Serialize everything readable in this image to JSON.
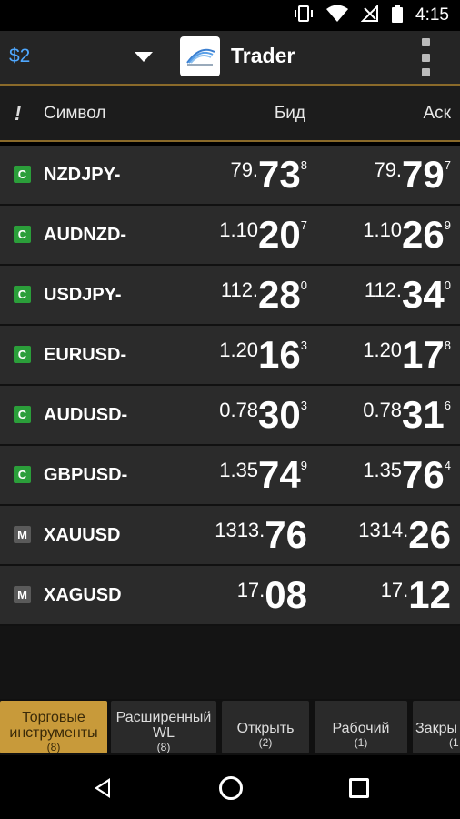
{
  "status_bar": {
    "time": "4:15"
  },
  "app_bar": {
    "balance": "$2",
    "app_name": "Trader"
  },
  "column_headers": {
    "alert": "!",
    "symbol": "Символ",
    "bid": "Бид",
    "ask": "Аск"
  },
  "rows": [
    {
      "badge": "C",
      "symbol": "NZDJPY-",
      "bid": {
        "pre": "79.",
        "big": "73",
        "sup": "8"
      },
      "ask": {
        "pre": "79.",
        "big": "79",
        "sup": "7"
      }
    },
    {
      "badge": "C",
      "symbol": "AUDNZD-",
      "bid": {
        "pre": "1.10",
        "big": "20",
        "sup": "7"
      },
      "ask": {
        "pre": "1.10",
        "big": "26",
        "sup": "9"
      }
    },
    {
      "badge": "C",
      "symbol": "USDJPY-",
      "bid": {
        "pre": "112.",
        "big": "28",
        "sup": "0"
      },
      "ask": {
        "pre": "112.",
        "big": "34",
        "sup": "0"
      }
    },
    {
      "badge": "C",
      "symbol": "EURUSD-",
      "bid": {
        "pre": "1.20",
        "big": "16",
        "sup": "3"
      },
      "ask": {
        "pre": "1.20",
        "big": "17",
        "sup": "8"
      }
    },
    {
      "badge": "C",
      "symbol": "AUDUSD-",
      "bid": {
        "pre": "0.78",
        "big": "30",
        "sup": "3"
      },
      "ask": {
        "pre": "0.78",
        "big": "31",
        "sup": "6"
      }
    },
    {
      "badge": "C",
      "symbol": "GBPUSD-",
      "bid": {
        "pre": "1.35",
        "big": "74",
        "sup": "9"
      },
      "ask": {
        "pre": "1.35",
        "big": "76",
        "sup": "4"
      }
    },
    {
      "badge": "M",
      "symbol": "XAUUSD",
      "bid": {
        "pre": "1313.",
        "big": "76",
        "sup": ""
      },
      "ask": {
        "pre": "1314.",
        "big": "26",
        "sup": ""
      }
    },
    {
      "badge": "M",
      "symbol": "XAGUSD",
      "bid": {
        "pre": "17.",
        "big": "08",
        "sup": ""
      },
      "ask": {
        "pre": "17.",
        "big": "12",
        "sup": ""
      }
    }
  ],
  "tabs": [
    {
      "label": "Торговые инструменты",
      "count": "(8)",
      "active": true
    },
    {
      "label": "Расширенный WL",
      "count": "(8)",
      "active": false
    },
    {
      "label": "Открыть",
      "count": "(2)",
      "active": false
    },
    {
      "label": "Рабочий",
      "count": "(1)",
      "active": false
    },
    {
      "label": "Закры",
      "count": "(1",
      "active": false
    }
  ],
  "colors": {
    "accent": "#c89a3a",
    "balance": "#4fa8ff",
    "badge_c": "#2b9e3a",
    "badge_m": "#5a5a5a"
  }
}
